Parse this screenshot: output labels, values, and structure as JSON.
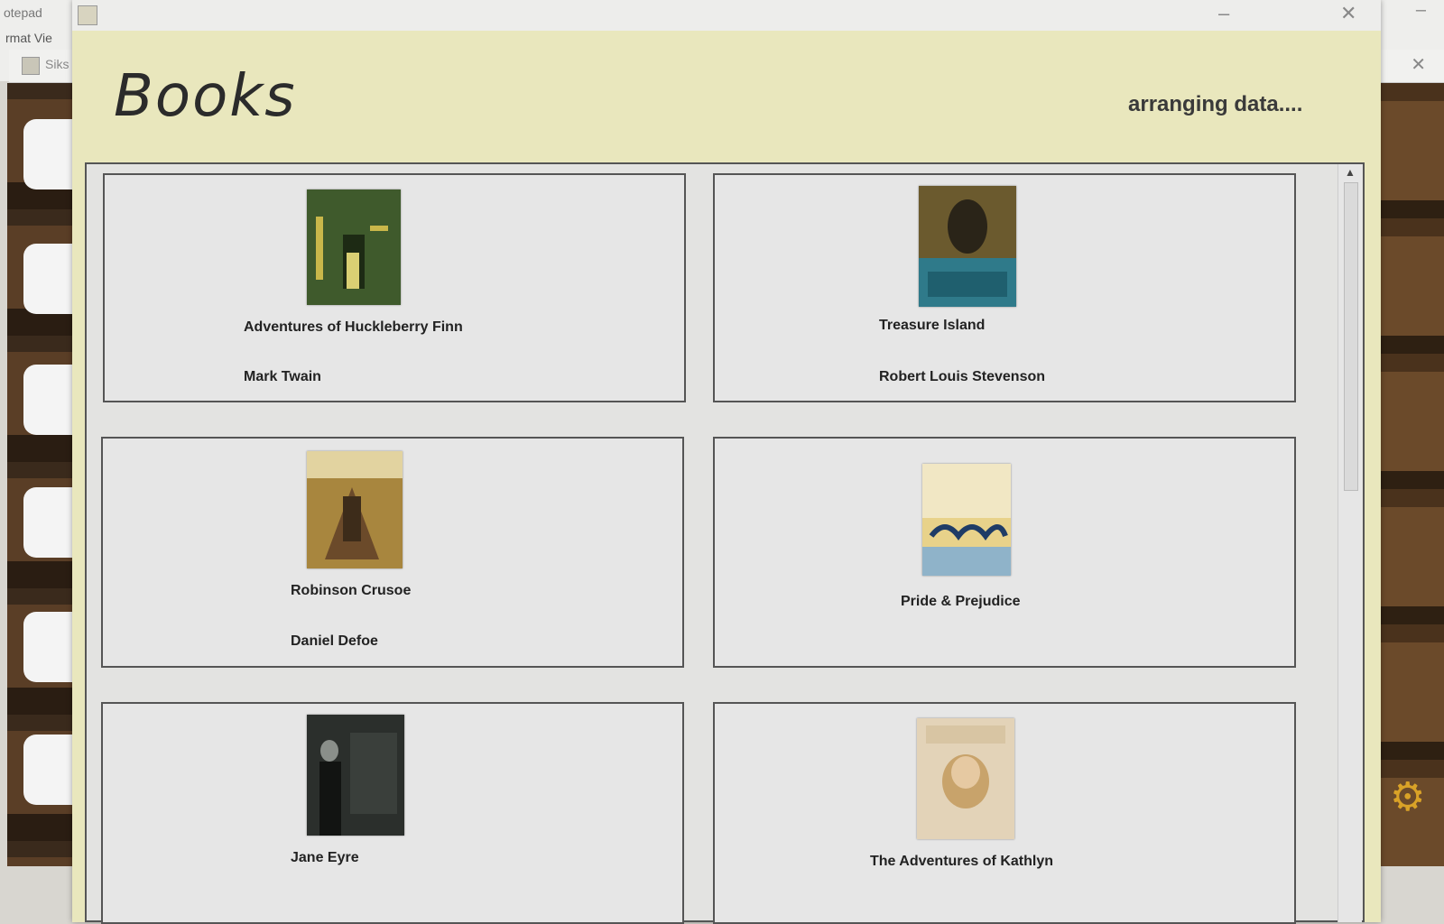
{
  "background": {
    "notepad_title": "otepad",
    "notepad_menu": "rmat   Vie",
    "other_window_label": "Siks"
  },
  "window": {
    "title": "Books",
    "status": "arranging data....",
    "minimize_glyph": "–",
    "close_glyph": "✕"
  },
  "books": [
    {
      "title": "Adventures of Huckleberry Finn",
      "author": "Mark Twain",
      "cover_color": "#3f5a2c"
    },
    {
      "title": "Treasure Island",
      "author": "Robert Louis Stevenson",
      "cover_color": "#6b5a2e"
    },
    {
      "title": "Robinson Crusoe",
      "author": "Daniel Defoe",
      "cover_color": "#a8863e"
    },
    {
      "title": "Pride & Prejudice",
      "author": "",
      "cover_color": "#e8d28a"
    },
    {
      "title": "Jane Eyre",
      "author": "",
      "cover_color": "#2b2f2c"
    },
    {
      "title": "The Adventures of Kathlyn",
      "author": "",
      "cover_color": "#e3d3b8"
    }
  ],
  "icons": {
    "gear": "⚙",
    "scroll_up": "▲"
  }
}
